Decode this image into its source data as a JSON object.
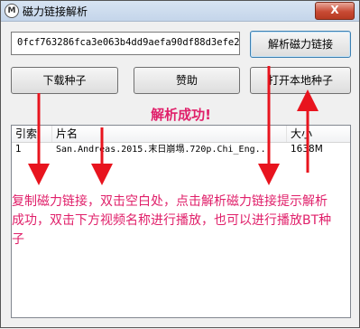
{
  "window": {
    "title": "磁力链接解析",
    "icon_letter": "M",
    "close_label": "X"
  },
  "magnet_input": {
    "value": "0fcf763286fca3e063b4dd9aefa90df88d3efe21"
  },
  "buttons": {
    "parse": "解析磁力链接",
    "download": "下载种子",
    "sponsor": "赞助",
    "open_local": "打开本地种子"
  },
  "status_text": "解析成功!",
  "list": {
    "columns": [
      "引索",
      "片名",
      "大小"
    ],
    "rows": [
      {
        "index": "1",
        "name": "San.Andreas.2015.末日崩塌.720p.Chi_Eng...",
        "size": "1638M"
      }
    ]
  },
  "instruction": "复制磁力链接，双击空白处，点击解析磁力链接提示解析成功，双击下方视频名称进行播放，也可以进行播放BT种子",
  "colors": {
    "annotation": "#e0206a",
    "arrow": "#e8141e"
  }
}
